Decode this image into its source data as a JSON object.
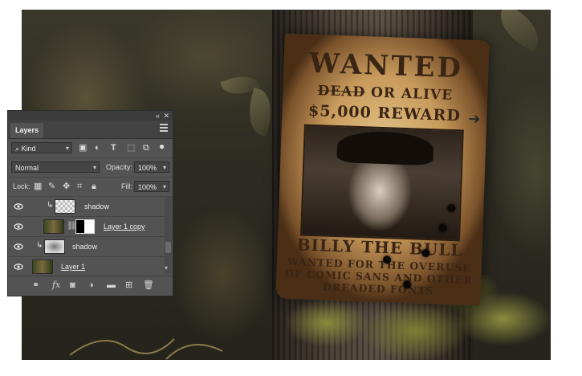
{
  "panel": {
    "tab_label": "Layers",
    "filter": {
      "label": "Kind"
    },
    "blend_mode": "Normal",
    "opacity": {
      "label": "Opacity:",
      "value": "100%"
    },
    "lock": {
      "label": "Lock:"
    },
    "fill": {
      "label": "Fill:",
      "value": "100%"
    },
    "layers": [
      {
        "name": "shadow",
        "clipped": true,
        "thumbnail": "transparent",
        "selected": false
      },
      {
        "name": "Layer 1 copy",
        "clipped": false,
        "thumbnail": "tree-with-mask",
        "selected": false
      },
      {
        "name": "shadow",
        "clipped": true,
        "thumbnail": "shadow",
        "selected": false
      },
      {
        "name": "Layer 1",
        "clipped": false,
        "thumbnail": "tree",
        "selected": false
      }
    ],
    "footer_icons": [
      "link-icon",
      "fx-icon",
      "mask-icon",
      "adjustment-icon",
      "folder-icon",
      "new-layer-icon",
      "trash-icon"
    ]
  },
  "poster": {
    "title": "WANTED",
    "dead": "DEAD",
    "or_alive": "OR ALIVE",
    "reward": "$5,000 REWARD",
    "name": "BILLY THE BULL",
    "line1": "WANTED FOR THE OVERUSE",
    "line2": "OF COMIC SANS AND OTHER",
    "line3": "DREADED FONTS"
  },
  "colors": {
    "panel_bg": "#535353",
    "panel_dark": "#424242",
    "poster_ink": "#3a2414"
  }
}
